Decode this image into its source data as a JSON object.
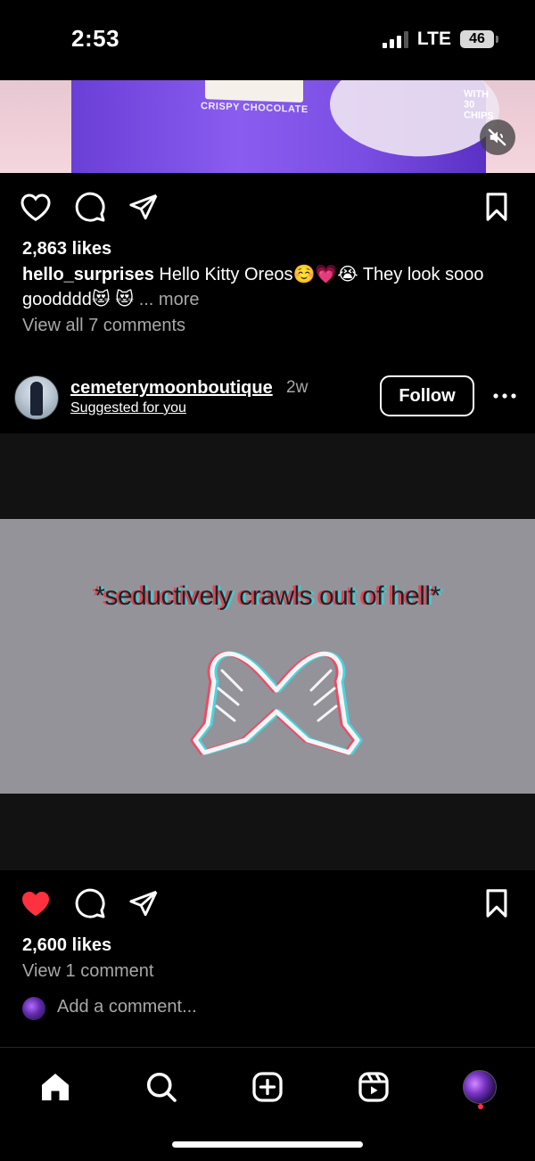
{
  "status_bar": {
    "time": "2:53",
    "network": "LTE",
    "battery": "46",
    "signal_bars_active": 3,
    "signal_bars_total": 4
  },
  "top_post": {
    "package_text": "CRISPY CHOCOLATE",
    "package_text_2": "WITH 30 CHIPS",
    "likes": "2,863 likes",
    "caption_user": "hello_surprises",
    "caption_text": "Hello Kitty Oreos☺️💗😭 They look sooo goodddd😻 😻",
    "more_label": "... more",
    "view_comments": "View all 7 comments",
    "liked": false
  },
  "suggested_post": {
    "username": "cemeterymoonboutique",
    "time_ago": "2w",
    "suggested_label": "Suggested for you",
    "follow_label": "Follow",
    "meme_text": "*seductively crawls out of hell*",
    "likes": "2,600 likes",
    "view_comments": "View 1 comment",
    "add_comment_placeholder": "Add a comment...",
    "liked": true
  },
  "colors": {
    "background": "#000000",
    "like_red": "#ff3040",
    "secondary_text": "#a8a8a8",
    "video_bg": "#949399"
  },
  "tab_bar": {
    "items": [
      "home-icon",
      "search-icon",
      "create-icon",
      "reels-icon",
      "profile-avatar"
    ]
  }
}
